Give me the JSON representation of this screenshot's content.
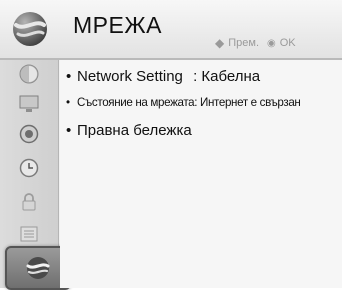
{
  "header": {
    "title": "МРЕЖА",
    "icon": "network-globe-icon",
    "hint_move": "Прем.",
    "hint_ok": "OK"
  },
  "sidebar": {
    "items": [
      {
        "icon": "picture-icon",
        "active": false
      },
      {
        "icon": "tv-screen-icon",
        "active": false
      },
      {
        "icon": "audio-icon",
        "active": false
      },
      {
        "icon": "clock-icon",
        "active": false
      },
      {
        "icon": "lock-icon",
        "active": false
      },
      {
        "icon": "options-icon",
        "active": false
      },
      {
        "icon": "network-icon",
        "active": true
      }
    ]
  },
  "menu": {
    "items": [
      {
        "bullet": "•",
        "label": "Network Setting",
        "separator": ":",
        "value": "Кабелна"
      },
      {
        "bullet": "•",
        "label": "Състояние на мрежата: Интернет е свързан"
      },
      {
        "bullet": "•",
        "label": "Правна бележка"
      }
    ]
  },
  "colors": {
    "header_bg": "#ececec",
    "sidebar_bg": "#d6d6d6",
    "active_item_bg": "#7f7f7f",
    "text": "#111111",
    "hint_text": "#9a9a9a"
  }
}
